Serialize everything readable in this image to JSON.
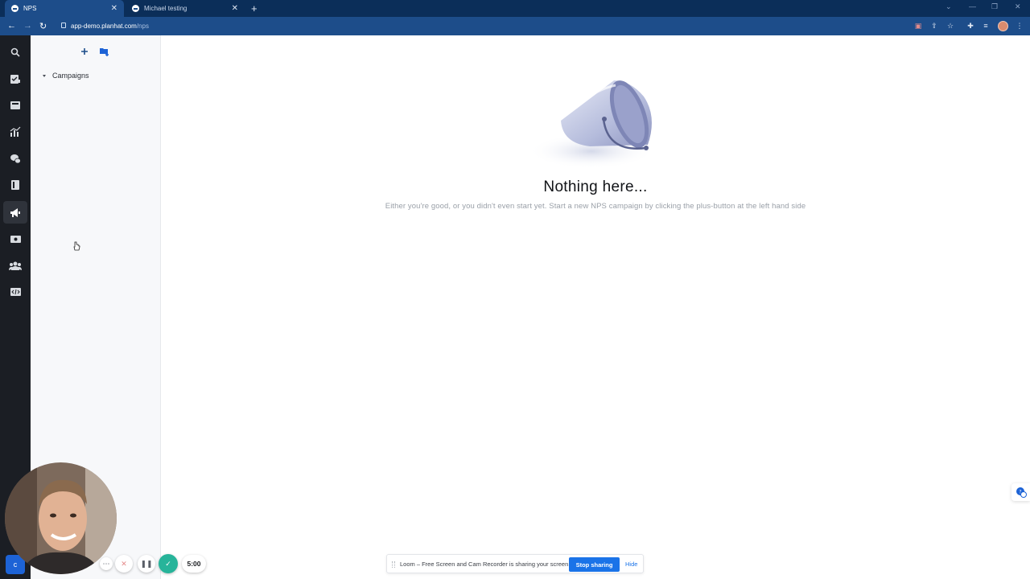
{
  "browser": {
    "tabs": [
      {
        "title": "NPS",
        "active": true
      },
      {
        "title": "Michael testing",
        "active": false
      }
    ],
    "url_host": "app-demo.planhat.com",
    "url_path": "/nps"
  },
  "rail": {
    "items": [
      "search-icon",
      "tasks-icon",
      "inbox-icon",
      "analytics-icon",
      "conversations-icon",
      "library-icon",
      "nps-megaphone-icon",
      "revenue-icon",
      "users-icon",
      "dev-icon"
    ],
    "active": "nps-megaphone-icon",
    "bottom_label": "c"
  },
  "sidebar": {
    "campaigns_label": "Campaigns"
  },
  "empty_state": {
    "title": "Nothing here...",
    "subtitle": "Either you're good, or you didn't even start yet. Start a new NPS campaign by clicking the plus-button at the left hand side"
  },
  "loom": {
    "timer": "5:00",
    "share_text": "Loom – Free Screen and Cam Recorder is sharing your screen.",
    "stop_label": "Stop sharing",
    "hide_label": "Hide"
  },
  "colors": {
    "browser_tabstrip": "#0b2e59",
    "browser_toolbar": "#1d4d8a",
    "rail_bg": "#1b1e24",
    "panel_bg": "#f7f8fa",
    "accent_blue": "#1a73e8",
    "loom_green": "#27b49a"
  }
}
